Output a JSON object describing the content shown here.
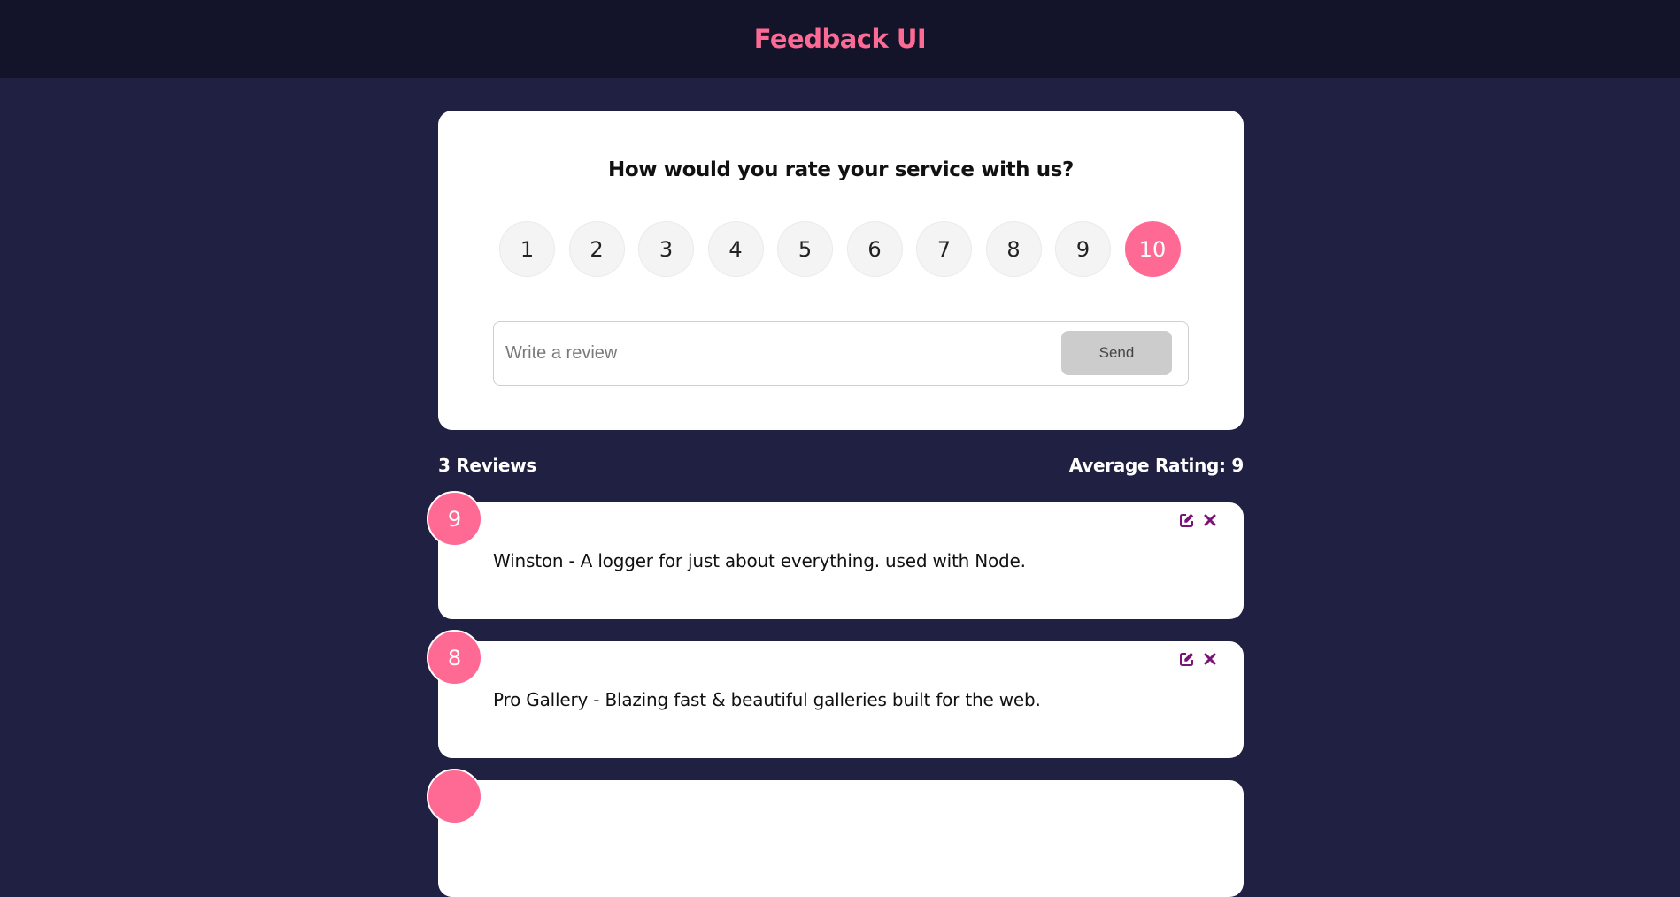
{
  "header": {
    "title": "Feedback UI"
  },
  "rating": {
    "question": "How would you rate your service with us?",
    "options": [
      "1",
      "2",
      "3",
      "4",
      "5",
      "6",
      "7",
      "8",
      "9",
      "10"
    ],
    "selected": "10"
  },
  "form": {
    "placeholder": "Write a review",
    "value": "",
    "send_label": "Send"
  },
  "stats": {
    "count_label": "3 Reviews",
    "average_label": "Average Rating: 9"
  },
  "feedback": [
    {
      "rating": "9",
      "text": "Winston - A logger for just about everything. used with Node."
    },
    {
      "rating": "8",
      "text": "Pro Gallery - Blazing fast & beautiful galleries built for the web."
    },
    {
      "rating": "",
      "text": ""
    }
  ],
  "icons": {
    "edit": "edit-icon",
    "close": "close-icon"
  },
  "colors": {
    "accent": "#ff6a95",
    "background": "#202142",
    "header": "#13142a",
    "icon": "#7b1278",
    "send_disabled": "#cccccc"
  }
}
